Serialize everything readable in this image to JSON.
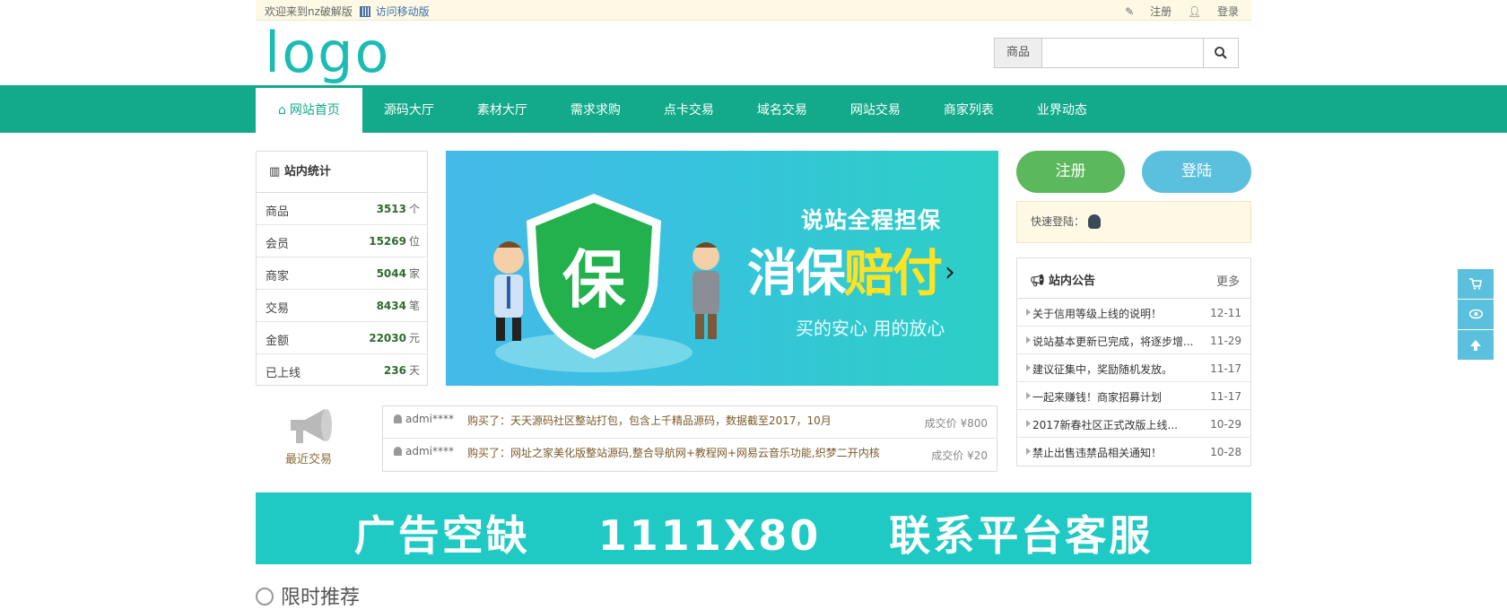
{
  "topbar": {
    "welcome": "欢迎来到nz破解版",
    "mobile_link": "访问移动版",
    "register": "注册",
    "login": "登录"
  },
  "header": {
    "logo": "logo",
    "search_category": "商品",
    "search_placeholder": ""
  },
  "nav": {
    "items": [
      "网站首页",
      "源码大厅",
      "素材大厅",
      "需求求购",
      "点卡交易",
      "域名交易",
      "网站交易",
      "商家列表",
      "业界动态"
    ],
    "active_index": 0
  },
  "stats": {
    "title": "站内统计",
    "rows": [
      {
        "label": "商品",
        "value": "3513",
        "unit": "个"
      },
      {
        "label": "会员",
        "value": "15269",
        "unit": "位"
      },
      {
        "label": "商家",
        "value": "5044",
        "unit": "家"
      },
      {
        "label": "交易",
        "value": "8434",
        "unit": "笔"
      },
      {
        "label": "金额",
        "value": "22030",
        "unit": "元"
      },
      {
        "label": "已上线",
        "value": "236",
        "unit": "天"
      }
    ]
  },
  "banner": {
    "line1": "说站全程担保",
    "line2a": "消保",
    "line2b": "赔付",
    "line3": "买的安心 用的放心",
    "shield_char": "保"
  },
  "side": {
    "register_btn": "注册",
    "login_btn": "登陆",
    "quick_login": "快速登陆："
  },
  "notice": {
    "title": "站内公告",
    "more": "更多",
    "items": [
      {
        "text": "关于信用等级上线的说明！",
        "date": "12-11"
      },
      {
        "text": "说站基本更新已完成，将逐步增...",
        "date": "11-29"
      },
      {
        "text": "建议征集中，奖励随机发放。",
        "date": "11-17"
      },
      {
        "text": "一起来赚钱！商家招募计划",
        "date": "11-17"
      },
      {
        "text": "2017新春社区正式改版上线...",
        "date": "10-29"
      },
      {
        "text": "禁止出售违禁品相关通知！",
        "date": "10-28"
      }
    ]
  },
  "recent": {
    "label": "最近交易",
    "trades": [
      {
        "user": "admi****",
        "desc": "购买了：天天源码社区整站打包，包含上千精品源码，数据截至2017，10月",
        "price": "成交价 ¥800"
      },
      {
        "user": "admi****",
        "desc": "购买了：网址之家美化版整站源码,整合导航网+教程网+网易云音乐功能,织梦二开内核",
        "price": "成交价 ¥20"
      }
    ]
  },
  "ad": {
    "text": "广告空缺    1111X80    联系平台客服"
  },
  "section": {
    "title": "限时推荐"
  },
  "colors": {
    "primary": "#13a98b",
    "logo": "#1cbcb4",
    "register": "#5cb85c",
    "login": "#5bc0de",
    "ad": "#1fcac5"
  },
  "float_icons": [
    "cart-icon",
    "eye-icon",
    "arrow-up-icon"
  ]
}
